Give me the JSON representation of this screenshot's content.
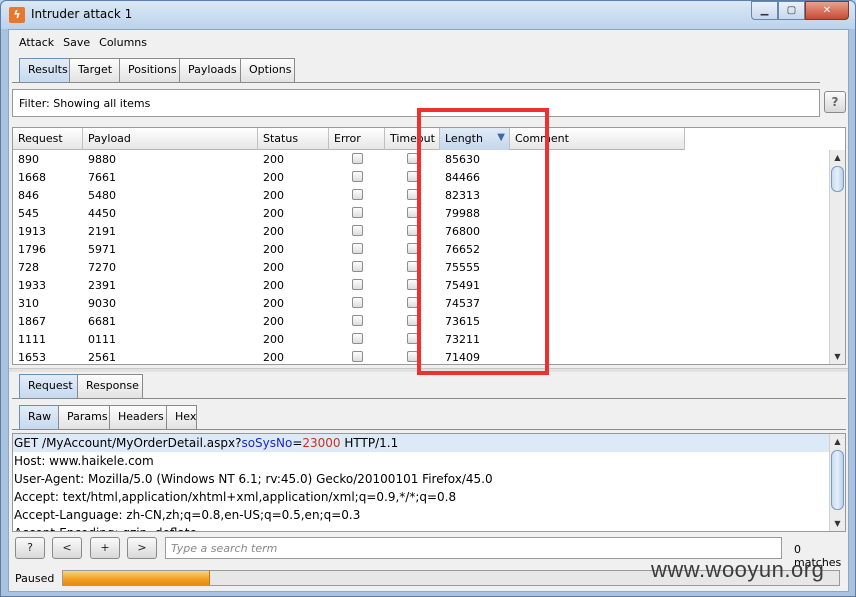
{
  "window": {
    "title": "Intruder attack 1",
    "controls": {
      "minimize": "▁",
      "maximize": "▢",
      "close": "✕"
    }
  },
  "menu": [
    "Attack",
    "Save",
    "Columns"
  ],
  "main_tabs": [
    {
      "label": "Results",
      "active": true
    },
    {
      "label": "Target",
      "active": false
    },
    {
      "label": "Positions",
      "active": false
    },
    {
      "label": "Payloads",
      "active": false
    },
    {
      "label": "Options",
      "active": false
    }
  ],
  "filter": {
    "text": "Filter:  Showing all items",
    "help": "?"
  },
  "results_table": {
    "columns": [
      "Request",
      "Payload",
      "Status",
      "Error",
      "Timeout",
      "Length",
      "Comment"
    ],
    "sorted_column": "Length",
    "rows": [
      {
        "request": "890",
        "payload": "9880",
        "status": "200",
        "length": "85630"
      },
      {
        "request": "1668",
        "payload": "7661",
        "status": "200",
        "length": "84466"
      },
      {
        "request": "846",
        "payload": "5480",
        "status": "200",
        "length": "82313"
      },
      {
        "request": "545",
        "payload": "4450",
        "status": "200",
        "length": "79988"
      },
      {
        "request": "1913",
        "payload": "2191",
        "status": "200",
        "length": "76800"
      },
      {
        "request": "1796",
        "payload": "5971",
        "status": "200",
        "length": "76652"
      },
      {
        "request": "728",
        "payload": "7270",
        "status": "200",
        "length": "75555"
      },
      {
        "request": "1933",
        "payload": "2391",
        "status": "200",
        "length": "75491"
      },
      {
        "request": "310",
        "payload": "9030",
        "status": "200",
        "length": "74537"
      },
      {
        "request": "1867",
        "payload": "6681",
        "status": "200",
        "length": "73615"
      },
      {
        "request": "1111",
        "payload": "0111",
        "status": "200",
        "length": "73211"
      },
      {
        "request": "1653",
        "payload": "2561",
        "status": "200",
        "length": "71409"
      }
    ]
  },
  "detail_tabs": [
    {
      "label": "Request",
      "active": true
    },
    {
      "label": "Response",
      "active": false
    }
  ],
  "view_tabs": [
    {
      "label": "Raw",
      "active": true
    },
    {
      "label": "Params",
      "active": false
    },
    {
      "label": "Headers",
      "active": false
    },
    {
      "label": "Hex",
      "active": false
    }
  ],
  "request": {
    "line1": {
      "prefix": "GET /MyAccount/MyOrderDetail.aspx?",
      "param": "soSysNo",
      "eq": "=",
      "value": "23000",
      "suffix": " HTTP/1.1"
    },
    "headers": [
      "Host: www.haikele.com",
      "User-Agent: Mozilla/5.0 (Windows NT 6.1; rv:45.0) Gecko/20100101 Firefox/45.0",
      "Accept: text/html,application/xhtml+xml,application/xml;q=0.9,*/*;q=0.8",
      "Accept-Language: zh-CN,zh;q=0.8,en-US;q=0.5,en;q=0.3",
      "Accept-Encoding: gzip, deflate"
    ]
  },
  "search": {
    "help": "?",
    "prev": "<",
    "add": "+",
    "next": ">",
    "placeholder": "Type a search term",
    "matches": "0 matches"
  },
  "status": {
    "text": "Paused",
    "progress": 0.19
  },
  "watermark": "www.wooyun.org"
}
